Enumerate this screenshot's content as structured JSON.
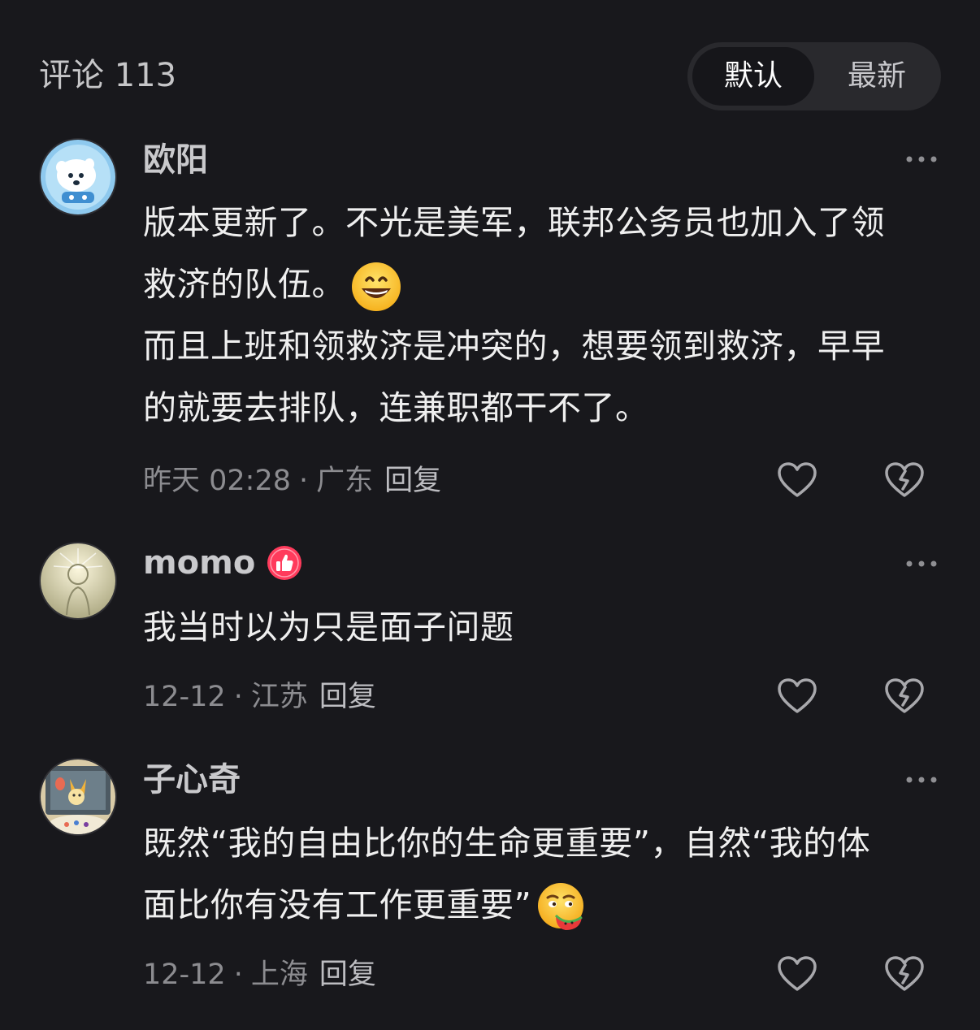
{
  "header": {
    "title": "评论 113",
    "sort_options": [
      {
        "label": "默认",
        "active": true
      },
      {
        "label": "最新",
        "active": false
      }
    ]
  },
  "comments": [
    {
      "user": "欧阳",
      "avatar": "polar-bear-avatar",
      "badge": null,
      "lines": [
        "版本更新了。不光是美军，联邦公务员也加入了领",
        "救济的队伍。",
        "而且上班和领救济是冲突的，想要领到救济，早早",
        "的就要去排队，连兼职都干不了。"
      ],
      "emoji": "grinning-face-emoji",
      "time": "昨天 02:28",
      "location": "广东",
      "reply_label": "回复"
    },
    {
      "user": "momo",
      "avatar": "sketch-figure-avatar",
      "badge": "thumbs-up-badge-icon",
      "lines": [
        "我当时以为只是面子问题"
      ],
      "time": "12-12",
      "location": "江苏",
      "reply_label": "回复"
    },
    {
      "user": "子心奇",
      "avatar": "cartoon-fox-avatar",
      "badge": null,
      "lines": [
        "既然“我的自由比你的生命更重要”，自然“我的体",
        "面比你有没有工作更重要”"
      ],
      "emoji": "eating-watermelon-emoji",
      "time": "12-12",
      "location": "上海",
      "reply_label": "回复"
    }
  ],
  "colors": {
    "background": "#18181c",
    "text": "#efefef",
    "meta": "#8c8c90",
    "icon": "#a8a8ac",
    "badge": "#ff3b5c"
  }
}
